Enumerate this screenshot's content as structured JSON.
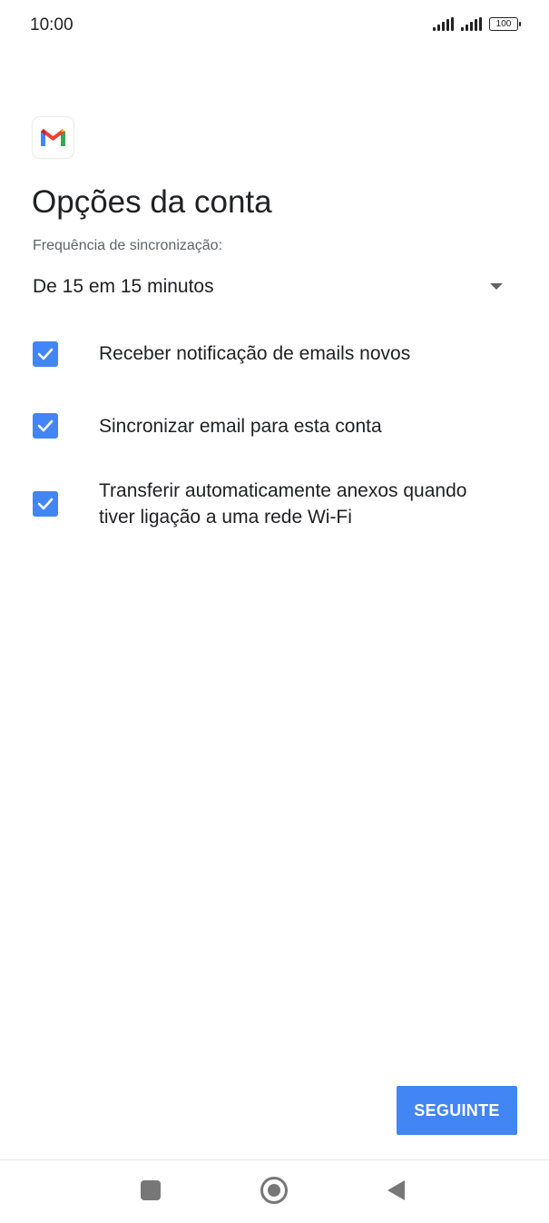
{
  "status_bar": {
    "time": "10:00",
    "battery": "100"
  },
  "header": {
    "logo_icon": "gmail-logo-icon",
    "title": "Opções da conta"
  },
  "sync": {
    "label": "Frequência de sincronização:",
    "selected": "De 15 em 15 minutos",
    "dropdown_icon": "chevron-down-icon"
  },
  "options": [
    {
      "label": "Receber notificação de emails novos",
      "checked": true
    },
    {
      "label": "Sincronizar email para esta conta",
      "checked": true
    },
    {
      "label": "Transferir automaticamente anexos quando tiver ligação a uma rede Wi-Fi",
      "checked": true
    }
  ],
  "actions": {
    "next_label": "SEGUINTE"
  },
  "colors": {
    "accent": "#4285f4",
    "text_primary": "#202124",
    "text_secondary": "#5f6368"
  },
  "nav_bar": {
    "recents_icon": "recents-square-icon",
    "home_icon": "home-circle-icon",
    "back_icon": "back-triangle-icon"
  }
}
